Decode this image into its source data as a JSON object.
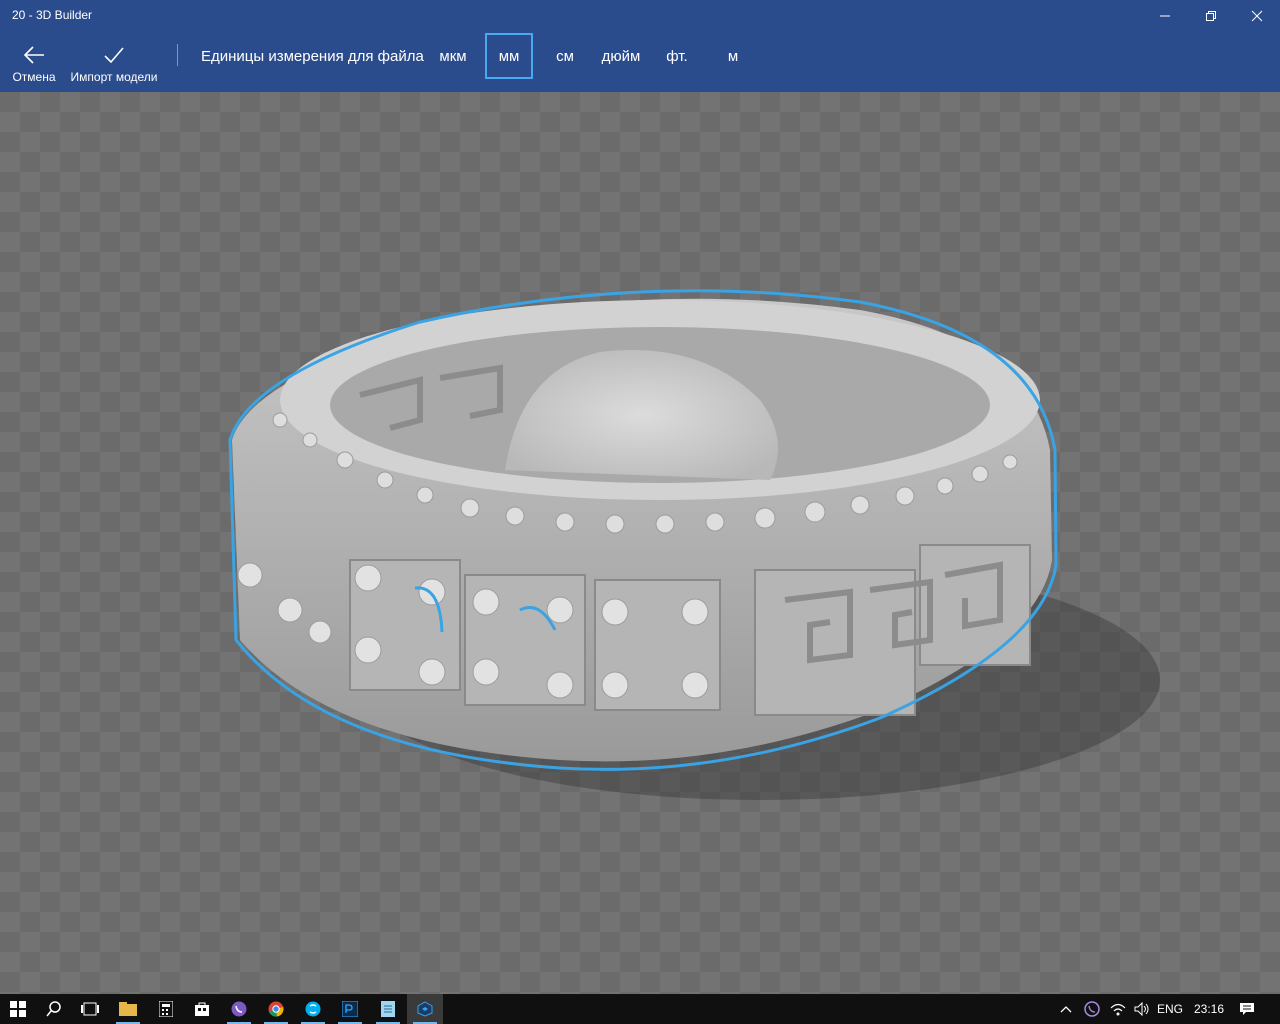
{
  "window": {
    "title": "20 - 3D Builder"
  },
  "toolbar": {
    "cancel_label": "Отмена",
    "import_label": "Импорт модели",
    "units_label": "Единицы измерения для файла",
    "units": [
      {
        "label": "мкм",
        "selected": false
      },
      {
        "label": "мм",
        "selected": true
      },
      {
        "label": "см",
        "selected": false
      },
      {
        "label": "дюйм",
        "selected": false
      },
      {
        "label": "фт.",
        "selected": false
      },
      {
        "label": "м",
        "selected": false
      }
    ]
  },
  "viewport": {
    "model": "ring-model",
    "selection_outline_color": "#3aa3e3"
  },
  "taskbar": {
    "apps": [
      "start-icon",
      "search-icon",
      "task-view-icon",
      "file-explorer-icon",
      "calculator-icon",
      "store-icon",
      "viber-icon",
      "chrome-icon",
      "skype-icon",
      "photoshop-icon",
      "notepad-icon",
      "3d-builder-icon"
    ],
    "language": "ENG",
    "clock": "23:16"
  },
  "colors": {
    "accent": "#2b4c8c",
    "selection": "#4aa8ee",
    "taskbar": "#101010"
  }
}
